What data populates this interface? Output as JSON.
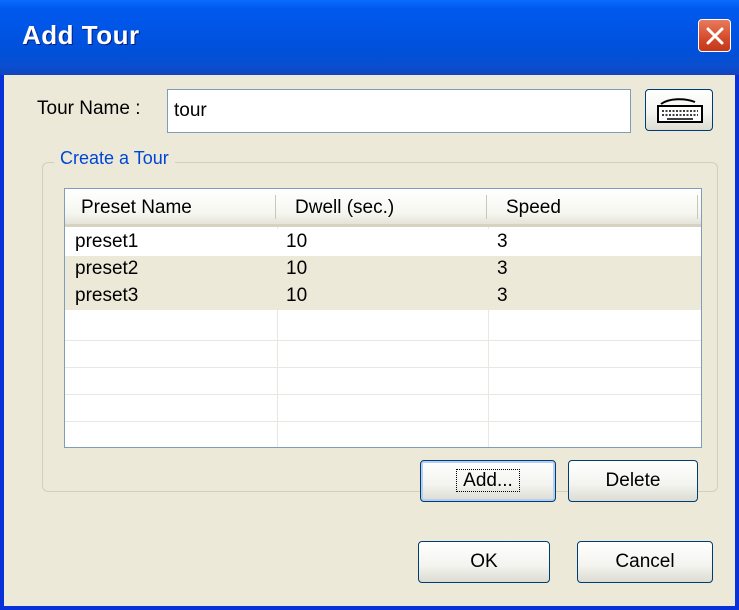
{
  "window": {
    "title": "Add Tour"
  },
  "form": {
    "tour_name_label": "Tour Name :",
    "tour_name_value": "tour",
    "group_label": "Create a Tour"
  },
  "table": {
    "columns": [
      "Preset Name",
      "Dwell (sec.)",
      "Speed"
    ],
    "rows": [
      {
        "preset": "preset1",
        "dwell": "10",
        "speed": "3"
      },
      {
        "preset": "preset2",
        "dwell": "10",
        "speed": "3"
      },
      {
        "preset": "preset3",
        "dwell": "10",
        "speed": "3"
      }
    ]
  },
  "buttons": {
    "add": "Add...",
    "delete": "Delete",
    "ok": "OK",
    "cancel": "Cancel"
  },
  "colors": {
    "titlebar": "#0055e5",
    "row_alt": "#ece9d8",
    "group_label": "#0046d5",
    "close": "#d54a2b"
  }
}
